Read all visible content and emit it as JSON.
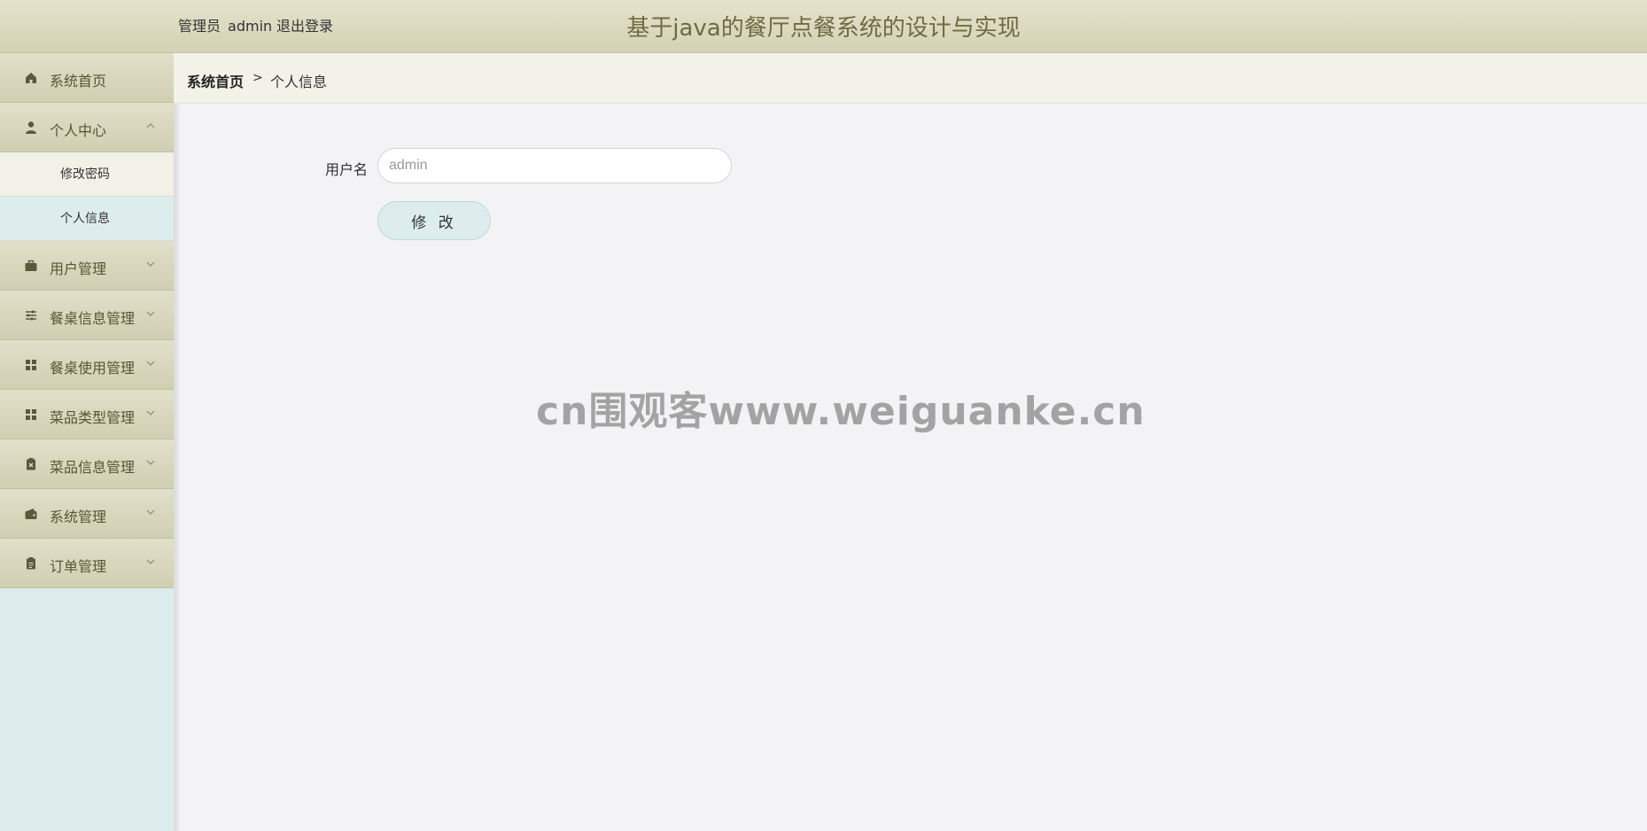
{
  "header": {
    "role": "管理员",
    "username": "admin",
    "logout": "退出登录",
    "title": "基于java的餐厅点餐系统的设计与实现"
  },
  "sidebar": {
    "items": [
      {
        "label": "系统首页",
        "icon": "home-icon"
      },
      {
        "label": "个人中心",
        "icon": "user-icon",
        "expanded": true,
        "children": [
          {
            "label": "修改密码"
          },
          {
            "label": "个人信息"
          }
        ]
      },
      {
        "label": "用户管理",
        "icon": "briefcase-icon"
      },
      {
        "label": "餐桌信息管理",
        "icon": "sliders-icon"
      },
      {
        "label": "餐桌使用管理",
        "icon": "grid-icon"
      },
      {
        "label": "菜品类型管理",
        "icon": "grid-icon"
      },
      {
        "label": "菜品信息管理",
        "icon": "clipboard-x-icon"
      },
      {
        "label": "系统管理",
        "icon": "wallet-icon"
      },
      {
        "label": "订单管理",
        "icon": "clipboard-icon"
      }
    ]
  },
  "breadcrumb": {
    "home": "系统首页",
    "separator": ">",
    "current": "个人信息"
  },
  "form": {
    "username_label": "用户名",
    "username_placeholder": "admin",
    "submit_label": "修 改"
  },
  "watermark": "cn围观客www.weiguanke.cn",
  "colors": {
    "header_bg": "#d8d7bb",
    "title": "#6f6c42",
    "sidebar_bg": "#dcecec",
    "menu_text": "#565632",
    "button_bg": "#ddeded"
  }
}
